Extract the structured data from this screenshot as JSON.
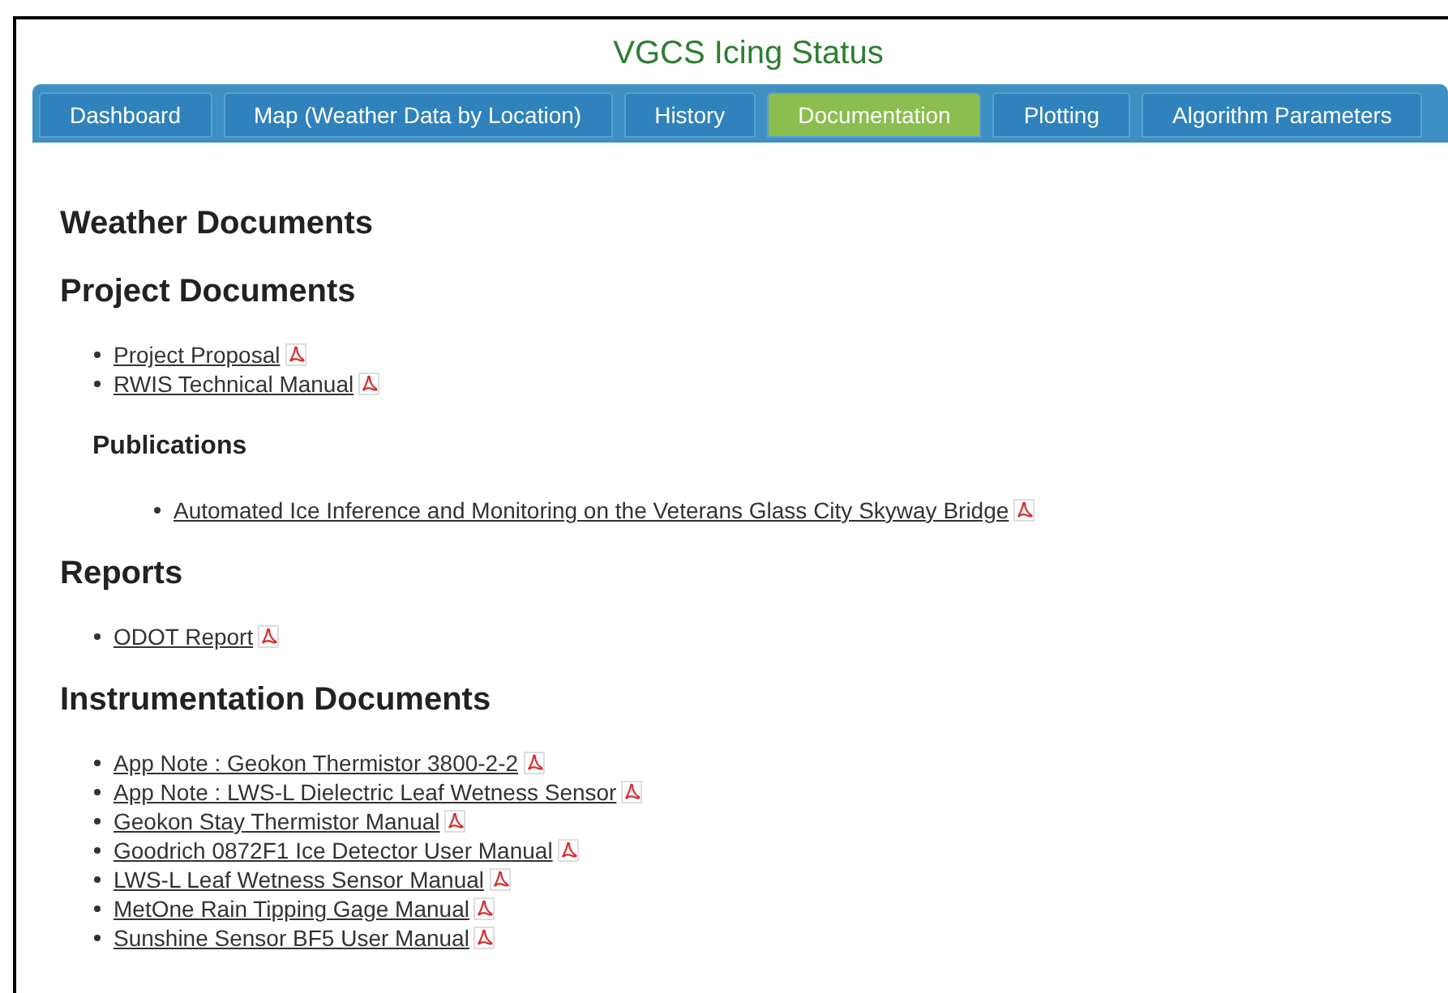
{
  "title": "VGCS Icing Status",
  "tabs": [
    {
      "label": "Dashboard",
      "selected": false
    },
    {
      "label": "Map (Weather Data by Location)",
      "selected": false
    },
    {
      "label": "History",
      "selected": false
    },
    {
      "label": "Documentation",
      "selected": true
    },
    {
      "label": "Plotting",
      "selected": false
    },
    {
      "label": "Algorithm Parameters",
      "selected": false
    }
  ],
  "sections": [
    {
      "heading": "Weather Documents"
    },
    {
      "heading": "Project Documents",
      "documents": [
        "Project Proposal",
        "RWIS Technical Manual"
      ],
      "subsections": [
        {
          "heading": "Publications",
          "documents": [
            "Automated Ice Inference and Monitoring on the Veterans Glass City Skyway Bridge"
          ]
        }
      ]
    },
    {
      "heading": "Reports",
      "documents": [
        "ODOT Report"
      ]
    },
    {
      "heading": "Instrumentation Documents",
      "documents": [
        "App Note : Geokon Thermistor 3800-2-2",
        "App Note : LWS-L Dielectric Leaf Wetness Sensor",
        "Geokon Stay Thermistor Manual",
        "Goodrich 0872F1 Ice Detector User Manual",
        "LWS-L Leaf Wetness Sensor Manual",
        "MetOne Rain Tipping Gage Manual",
        "Sunshine Sensor BF5 User Manual"
      ]
    }
  ]
}
